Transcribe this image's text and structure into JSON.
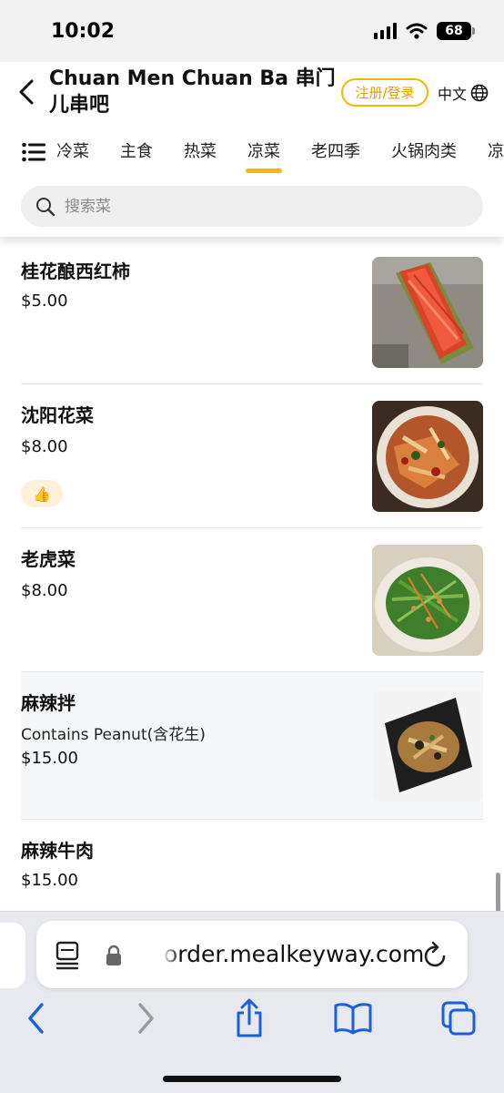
{
  "status": {
    "time": "10:02",
    "battery": "68"
  },
  "header": {
    "store_name": "Chuan Men Chuan Ba 串门儿串吧",
    "login_label": "注册/登录",
    "language": "中文"
  },
  "tabs": {
    "items": [
      "冷菜",
      "主食",
      "热菜",
      "凉菜",
      "老四季",
      "火锅肉类",
      "凉串"
    ],
    "active": "凉菜"
  },
  "search": {
    "placeholder": "搜索菜"
  },
  "dishes": [
    {
      "name": "桂花酿西红柿",
      "price": "$5.00",
      "note": "",
      "badge": "",
      "image": "sliced-tomato-photo"
    },
    {
      "name": "沈阳花菜",
      "price": "$8.00",
      "note": "",
      "badge": "👍",
      "image": "spicy-cabbage-photo"
    },
    {
      "name": "老虎菜",
      "price": "$8.00",
      "note": "",
      "badge": "",
      "image": "green-salad-photo"
    },
    {
      "name": "麻辣拌",
      "price": "$15.00",
      "note": "Contains Peanut(含花生)",
      "badge": "",
      "image": "spicy-mix-photo"
    },
    {
      "name": "麻辣牛肉",
      "price": "$15.00",
      "note": "",
      "badge": "",
      "image": ""
    }
  ],
  "browser": {
    "url": "order.mealkeyway.com"
  },
  "colors": {
    "accent": "#f5b800",
    "safari_blue": "#1a5fe0"
  }
}
